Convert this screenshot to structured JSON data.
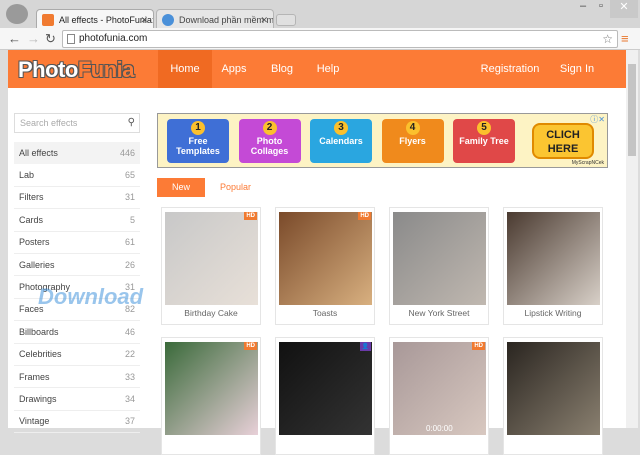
{
  "browser": {
    "tabs": [
      {
        "title": "All effects - PhotoFunia: F",
        "favicon_color": "#f07a30"
      },
      {
        "title": "Download phần mềm mi",
        "favicon_color": "#4a90d9"
      }
    ],
    "url": "photofunia.com"
  },
  "header": {
    "logo_a": "Photo",
    "logo_b": "Funia",
    "nav": [
      "Home",
      "Apps",
      "Blog",
      "Help"
    ],
    "right": [
      "Registration",
      "Sign In"
    ]
  },
  "sidebar": {
    "search_placeholder": "Search effects",
    "items": [
      {
        "label": "All effects",
        "count": "446"
      },
      {
        "label": "Lab",
        "count": "65"
      },
      {
        "label": "Filters",
        "count": "31"
      },
      {
        "label": "Cards",
        "count": "5"
      },
      {
        "label": "Posters",
        "count": "61"
      },
      {
        "label": "Galleries",
        "count": "26"
      },
      {
        "label": "Photography",
        "count": "31"
      },
      {
        "label": "Faces",
        "count": "82"
      },
      {
        "label": "Billboards",
        "count": "46"
      },
      {
        "label": "Celebrities",
        "count": "22"
      },
      {
        "label": "Frames",
        "count": "33"
      },
      {
        "label": "Drawings",
        "count": "34"
      },
      {
        "label": "Vintage",
        "count": "37"
      }
    ]
  },
  "ad": {
    "buttons": [
      {
        "n": "1",
        "label": "Free Templates",
        "color": "#3f6fd6"
      },
      {
        "n": "2",
        "label": "Photo Collages",
        "color": "#c44ad6"
      },
      {
        "n": "3",
        "label": "Calendars",
        "color": "#2aa6e0"
      },
      {
        "n": "4",
        "label": "Flyers",
        "color": "#f08a1c"
      },
      {
        "n": "5",
        "label": "Family Tree",
        "color": "#e04848"
      }
    ],
    "cta": "CLICH HERE",
    "brand": "MyScrapNCek"
  },
  "filters": {
    "new": "New",
    "popular": "Popular"
  },
  "effects": [
    {
      "label": "Birthday Cake",
      "badge": "HD",
      "colors": [
        "#c8c8c8",
        "#e8e0d8"
      ]
    },
    {
      "label": "Toasts",
      "badge": "HD",
      "colors": [
        "#7a4a2a",
        "#d8b080"
      ]
    },
    {
      "label": "New York Street",
      "badge": "",
      "colors": [
        "#8a8a8a",
        "#c0b8b0"
      ]
    },
    {
      "label": "Lipstick Writing",
      "badge": "",
      "colors": [
        "#4a3a30",
        "#d8d0c8"
      ]
    },
    {
      "label": "",
      "badge": "HD",
      "colors": [
        "#3a6a3a",
        "#e8d0d8"
      ]
    },
    {
      "label": "",
      "badge": "user",
      "colors": [
        "#111111",
        "#333333"
      ]
    },
    {
      "label": "",
      "badge": "HD",
      "colors": [
        "#a89898",
        "#d8c8c0"
      ]
    },
    {
      "label": "",
      "badge": "",
      "colors": [
        "#2a2520",
        "#8a8070"
      ]
    }
  ],
  "player_time": "0:00:00",
  "watermark": "Download"
}
